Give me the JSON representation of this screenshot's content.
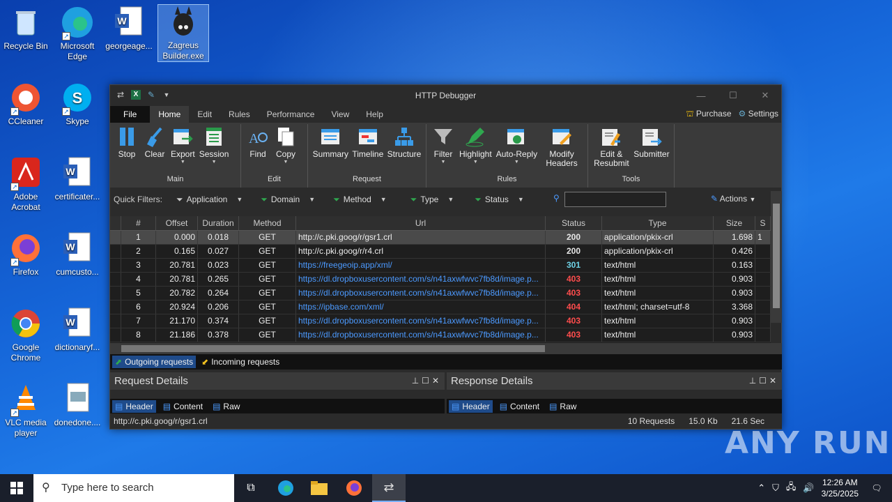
{
  "desktop": {
    "icons": [
      {
        "label": "Recycle Bin"
      },
      {
        "label": "Microsoft Edge"
      },
      {
        "label": "georgeage..."
      },
      {
        "label": "Zagreus Builder.exe"
      },
      {
        "label": "CCleaner"
      },
      {
        "label": "Skype"
      },
      {
        "label": "Adobe Acrobat"
      },
      {
        "label": "certificater..."
      },
      {
        "label": "Firefox"
      },
      {
        "label": "cumcusto..."
      },
      {
        "label": "Google Chrome"
      },
      {
        "label": "dictionaryf..."
      },
      {
        "label": "VLC media player"
      },
      {
        "label": "donedone...."
      }
    ]
  },
  "window": {
    "title": "HTTP Debugger",
    "menu": [
      "File",
      "Home",
      "Edit",
      "Rules",
      "Performance",
      "View",
      "Help"
    ],
    "purchase": "Purchase",
    "settings": "Settings"
  },
  "ribbon": {
    "groups": [
      {
        "label": "Main",
        "buttons": [
          "Stop",
          "Clear",
          "Export",
          "Session"
        ]
      },
      {
        "label": "Edit",
        "buttons": [
          "Find",
          "Copy"
        ]
      },
      {
        "label": "Request",
        "buttons": [
          "Summary",
          "Timeline",
          "Structure"
        ]
      },
      {
        "label": "Rules",
        "buttons": [
          "Filter",
          "Highlight",
          "Auto-Reply",
          "Modify Headers"
        ]
      },
      {
        "label": "Tools",
        "buttons": [
          "Edit & Resubmit",
          "Submitter"
        ]
      }
    ]
  },
  "filters": {
    "label": "Quick Filters:",
    "items": [
      "Application",
      "Domain",
      "Method",
      "Type",
      "Status"
    ],
    "actions": "Actions"
  },
  "grid": {
    "columns": [
      "#",
      "Offset",
      "Duration",
      "Method",
      "Url",
      "Status",
      "Type",
      "Size",
      "S"
    ],
    "rows": [
      {
        "n": "1",
        "offset": "0.000",
        "duration": "0.018",
        "method": "GET",
        "url": "http://c.pki.goog/r/gsr1.crl",
        "status": "200",
        "type": "application/pkix-crl",
        "size": "1.698",
        "s": "1"
      },
      {
        "n": "2",
        "offset": "0.165",
        "duration": "0.027",
        "method": "GET",
        "url": "http://c.pki.goog/r/r4.crl",
        "status": "200",
        "type": "application/pkix-crl",
        "size": "0.426",
        "s": ""
      },
      {
        "n": "3",
        "offset": "20.781",
        "duration": "0.023",
        "method": "GET",
        "url": "https://freegeoip.app/xml/",
        "status": "301",
        "type": "text/html",
        "size": "0.163",
        "s": ""
      },
      {
        "n": "4",
        "offset": "20.781",
        "duration": "0.265",
        "method": "GET",
        "url": "https://dl.dropboxusercontent.com/s/n41axwfwvc7fb8d/image.p...",
        "status": "403",
        "type": "text/html",
        "size": "0.903",
        "s": ""
      },
      {
        "n": "5",
        "offset": "20.782",
        "duration": "0.264",
        "method": "GET",
        "url": "https://dl.dropboxusercontent.com/s/n41axwfwvc7fb8d/image.p...",
        "status": "403",
        "type": "text/html",
        "size": "0.903",
        "s": ""
      },
      {
        "n": "6",
        "offset": "20.924",
        "duration": "0.206",
        "method": "GET",
        "url": "https://ipbase.com/xml/",
        "status": "404",
        "type": "text/html; charset=utf-8",
        "size": "3.368",
        "s": ""
      },
      {
        "n": "7",
        "offset": "21.170",
        "duration": "0.374",
        "method": "GET",
        "url": "https://dl.dropboxusercontent.com/s/n41axwfwvc7fb8d/image.p...",
        "status": "403",
        "type": "text/html",
        "size": "0.903",
        "s": ""
      },
      {
        "n": "8",
        "offset": "21.186",
        "duration": "0.378",
        "method": "GET",
        "url": "https://dl.dropboxusercontent.com/s/n41axwfwvc7fb8d/image.p...",
        "status": "403",
        "type": "text/html",
        "size": "0.903",
        "s": ""
      }
    ]
  },
  "bottom_tabs": {
    "outgoing": "Outgoing requests",
    "incoming": "Incoming requests"
  },
  "request_panel": {
    "title": "Request Details",
    "tabs": [
      "Header",
      "Content",
      "Raw"
    ]
  },
  "response_panel": {
    "title": "Response Details",
    "tabs": [
      "Header",
      "Content",
      "Raw"
    ]
  },
  "status_bar": {
    "url": "http://c.pki.goog/r/gsr1.crl",
    "requests": "10 Requests",
    "size": "15.0 Kb",
    "time": "21.6 Sec"
  },
  "taskbar": {
    "search_placeholder": "Type here to search",
    "time": "12:26 AM",
    "date": "3/25/2025"
  },
  "watermark": "ANY RUN",
  "colors": {
    "status_200": "#e8e8e8",
    "status_301": "#6fd3e8",
    "status_4xx": "#ff4d4d",
    "link": "#4c9aff",
    "plain_url": "#eeeeee"
  }
}
